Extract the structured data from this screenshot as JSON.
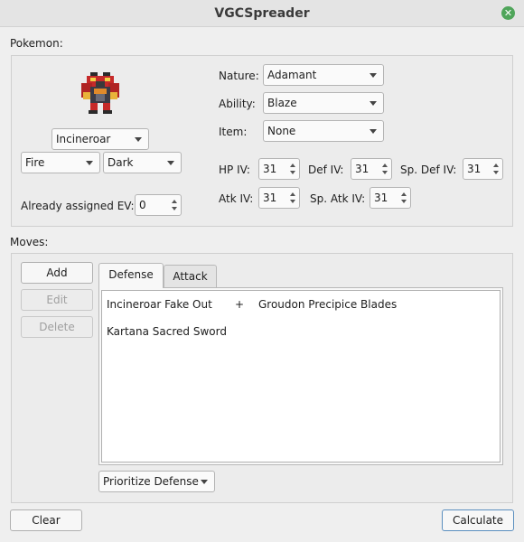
{
  "window": {
    "title": "VGCSpreader"
  },
  "pokemon_section": {
    "label": "Pokemon:",
    "species": "Incineroar",
    "type1": "Fire",
    "type2": "Dark",
    "assigned_ev_label": "Already assigned EV:",
    "assigned_ev_value": "0",
    "nature_label": "Nature:",
    "nature": "Adamant",
    "ability_label": "Ability:",
    "ability": "Blaze",
    "item_label": "Item:",
    "item": "None",
    "ivs": {
      "hp_label": "HP IV:",
      "hp": "31",
      "def_label": "Def IV:",
      "def": "31",
      "spdef_label": "Sp. Def IV:",
      "spdef": "31",
      "atk_label": "Atk IV:",
      "atk": "31",
      "spatk_label": "Sp. Atk IV:",
      "spatk": "31"
    }
  },
  "moves_section": {
    "label": "Moves:",
    "add": "Add",
    "edit": "Edit",
    "delete": "Delete",
    "tabs": [
      "Defense",
      "Attack"
    ],
    "entries": [
      {
        "move": "Incineroar Fake Out",
        "plus": "+",
        "partner": "Groudon Precipice Blades"
      },
      {
        "move": "Kartana Sacred Sword",
        "plus": "",
        "partner": ""
      }
    ],
    "priority": "Prioritize Defense"
  },
  "footer": {
    "clear": "Clear",
    "calculate": "Calculate"
  },
  "colors": {
    "accent": "#4fa55a",
    "focus_border": "#5b8fbf",
    "window_bg": "#efefef"
  }
}
